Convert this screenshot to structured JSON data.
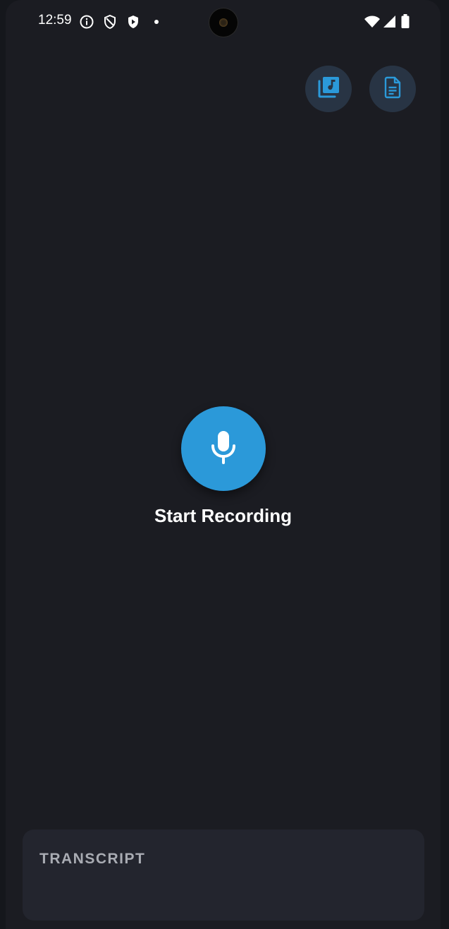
{
  "status_bar": {
    "time": "12:59",
    "left_icons": [
      "info-icon",
      "shield-outline-icon",
      "shield-play-icon",
      "dot-icon"
    ],
    "right_icons": [
      "wifi-icon",
      "signal-icon",
      "battery-icon"
    ]
  },
  "toolbar": {
    "buttons": [
      {
        "icon": "music-library-icon",
        "name": "library-button"
      },
      {
        "icon": "document-icon",
        "name": "transcripts-button"
      }
    ],
    "button_color": "#283444",
    "icon_color": "#2b99d9"
  },
  "recorder": {
    "icon": "microphone-icon",
    "label": "Start Recording",
    "accent": "#2b99d9"
  },
  "transcript": {
    "title": "TRANSCRIPT",
    "body": ""
  },
  "colors": {
    "background": "#1b1c22",
    "card": "#23252e"
  }
}
